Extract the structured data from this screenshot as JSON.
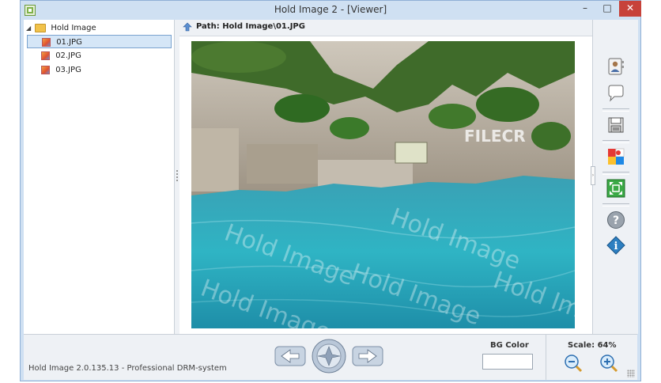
{
  "window": {
    "title": "Hold Image 2 - [Viewer]",
    "controls": {
      "minimize": "–",
      "maximize": "□",
      "close": "✕"
    }
  },
  "tree": {
    "root": {
      "expander": "◢",
      "label": "Hold Image",
      "icon": "folder-icon"
    },
    "files": [
      {
        "label": "01.JPG",
        "icon": "image-file-icon",
        "selected": true
      },
      {
        "label": "02.JPG",
        "icon": "image-file-icon",
        "selected": false
      },
      {
        "label": "03.JPG",
        "icon": "image-file-icon",
        "selected": false
      }
    ]
  },
  "viewer": {
    "path": "Path: Hold Image\\01.JPG",
    "photo_watermark_text": "Hold Image",
    "photo_logo_text": "FILECR"
  },
  "toolbar_right": {
    "buttons": [
      "contact-card-icon",
      "comment-icon",
      "save-icon",
      "color-palette-icon",
      "fit-screen-icon",
      "help-icon",
      "info-icon"
    ]
  },
  "bottom": {
    "status": "Hold Image 2.0.135.13 - Professional DRM-system",
    "bg_color_label": "BG Color",
    "bg_color_value": "#ffffff",
    "scale_label": "Scale: 64%"
  },
  "colors": {
    "titlebar": "#cfe0f2",
    "selection": "#d5e6f7",
    "close_button": "#c7423a"
  }
}
